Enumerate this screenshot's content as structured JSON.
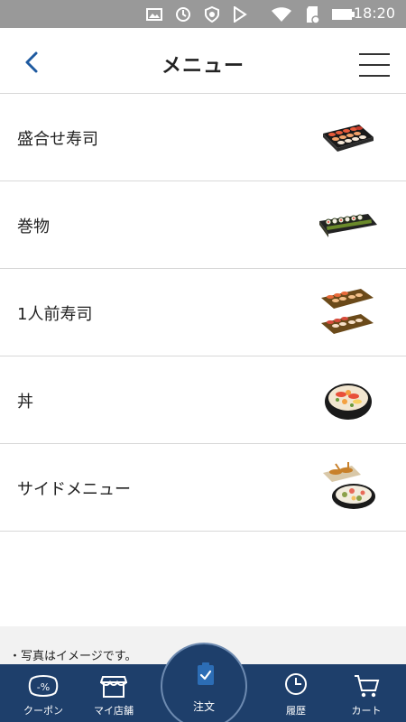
{
  "status_bar": {
    "time": "18:20"
  },
  "header": {
    "title": "メニュー"
  },
  "menu": {
    "items": [
      {
        "label": "盛合せ寿司",
        "thumb": "sushi-platter-icon"
      },
      {
        "label": "巻物",
        "thumb": "maki-roll-tray-icon"
      },
      {
        "label": "1人前寿司",
        "thumb": "single-serving-sushi-icon"
      },
      {
        "label": "丼",
        "thumb": "donburi-bowl-icon"
      },
      {
        "label": "サイドメニュー",
        "thumb": "side-dish-icon"
      }
    ]
  },
  "footer_note": "・写真はイメージです。",
  "bottom_nav": {
    "coupon": "クーポン",
    "my_store": "マイ店舗",
    "order": "注文",
    "history": "履歴",
    "cart": "カート"
  },
  "colors": {
    "nav_background": "#1e3f6b",
    "accent": "#2c6db5",
    "statusbar": "#999999"
  }
}
